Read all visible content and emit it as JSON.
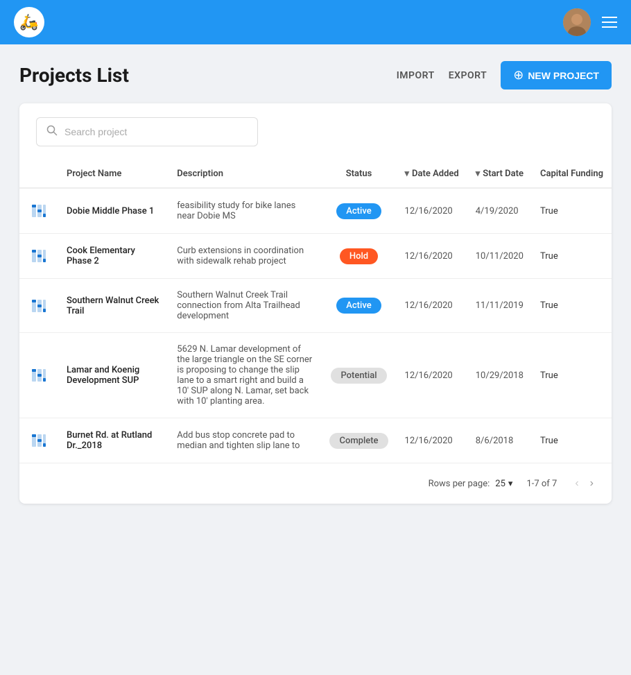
{
  "header": {
    "logo_emoji": "🛵",
    "hamburger_label": "menu"
  },
  "page": {
    "title": "Projects List",
    "actions": {
      "import_label": "IMPORT",
      "export_label": "EXPORT",
      "new_project_label": "NEW PROJECT"
    }
  },
  "search": {
    "placeholder": "Search project"
  },
  "table": {
    "columns": [
      {
        "key": "icon",
        "label": ""
      },
      {
        "key": "name",
        "label": "Project Name"
      },
      {
        "key": "description",
        "label": "Description"
      },
      {
        "key": "status",
        "label": "Status"
      },
      {
        "key": "date_added",
        "label": "Date Added",
        "sortable": true
      },
      {
        "key": "start_date",
        "label": "Start Date",
        "sortable": true
      },
      {
        "key": "capital_funding",
        "label": "Capital Funding"
      }
    ],
    "rows": [
      {
        "name": "Dobie Middle Phase 1",
        "description": "feasibility study for bike lanes near Dobie MS",
        "status": "Active",
        "status_type": "active",
        "date_added": "12/16/2020",
        "start_date": "4/19/2020",
        "capital_funding": "True"
      },
      {
        "name": "Cook Elementary Phase 2",
        "description": "Curb extensions in coordination with sidewalk rehab project",
        "status": "Hold",
        "status_type": "hold",
        "date_added": "12/16/2020",
        "start_date": "10/11/2020",
        "capital_funding": "True"
      },
      {
        "name": "Southern Walnut Creek Trail",
        "description": "Southern Walnut Creek Trail connection from Alta Trailhead development",
        "status": "Active",
        "status_type": "active",
        "date_added": "12/16/2020",
        "start_date": "11/11/2019",
        "capital_funding": "True"
      },
      {
        "name": "Lamar and Koenig Development SUP",
        "description": "5629 N. Lamar development of the large triangle on the SE corner is proposing to change the slip lane to a smart right and build a 10' SUP along N. Lamar, set back with 10' planting area.",
        "status": "Potential",
        "status_type": "potential",
        "date_added": "12/16/2020",
        "start_date": "10/29/2018",
        "capital_funding": "True"
      },
      {
        "name": "Burnet Rd. at Rutland Dr._2018",
        "description": "Add bus stop concrete pad to median and tighten slip lane to",
        "status": "Complete",
        "status_type": "complete",
        "date_added": "12/16/2020",
        "start_date": "8/6/2018",
        "capital_funding": "True"
      }
    ]
  },
  "pagination": {
    "rows_per_page_label": "Rows per page:",
    "rows_per_page_value": "25",
    "page_info": "1-7 of 7"
  }
}
